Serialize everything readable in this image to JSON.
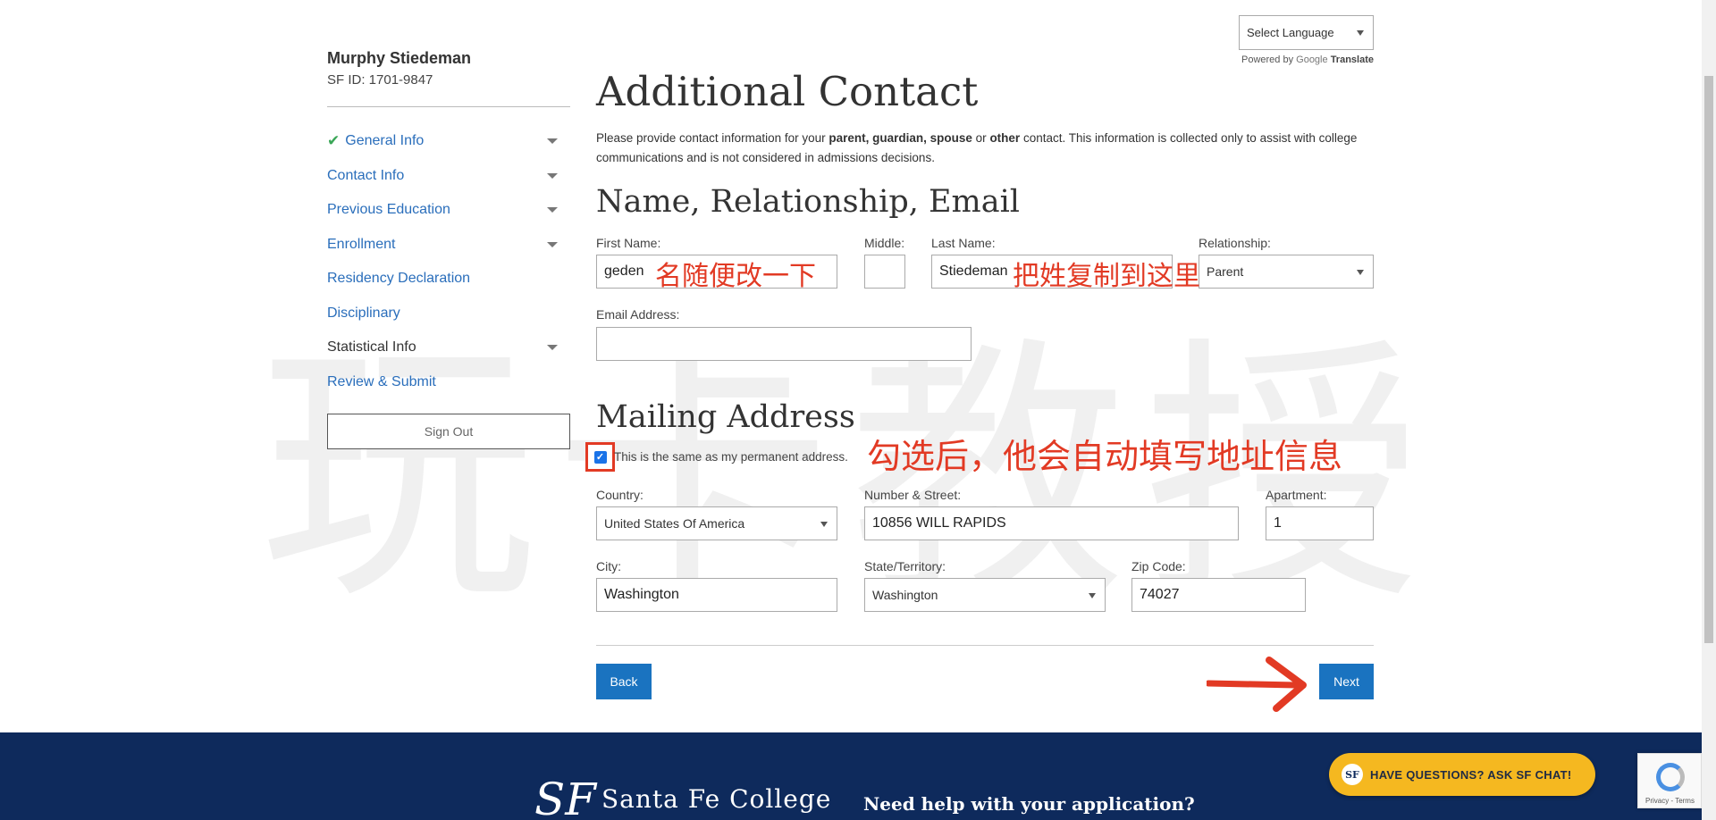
{
  "user": {
    "name": "Murphy Stiedeman",
    "id": "SF ID: 1701-9847"
  },
  "nav": [
    {
      "label": "General Info",
      "done": true,
      "caret": true,
      "dark": false
    },
    {
      "label": "Contact Info",
      "done": false,
      "caret": true,
      "dark": false
    },
    {
      "label": "Previous Education",
      "done": false,
      "caret": true,
      "dark": false
    },
    {
      "label": "Enrollment",
      "done": false,
      "caret": true,
      "dark": false
    },
    {
      "label": "Residency Declaration",
      "done": false,
      "caret": false,
      "dark": false
    },
    {
      "label": "Disciplinary",
      "done": false,
      "caret": false,
      "dark": false
    },
    {
      "label": "Statistical Info",
      "done": false,
      "caret": true,
      "dark": true
    },
    {
      "label": "Review & Submit",
      "done": false,
      "caret": false,
      "dark": false
    }
  ],
  "signout_label": "Sign Out",
  "language": {
    "select_label": "Select Language",
    "powered_by": "Powered by",
    "google": "Google",
    "translate": "Translate"
  },
  "page": {
    "title": "Additional Contact",
    "intro_before": "Please provide contact information for your ",
    "intro_bold1": "parent, guardian, spouse",
    "intro_mid": " or ",
    "intro_bold2": "other",
    "intro_after": " contact. This information is collected only to assist with college communications and is not considered in admissions decisions."
  },
  "section_name": {
    "heading": "Name, Relationship, Email",
    "first_name_label": "First Name:",
    "first_name_value": "geden",
    "middle_label": "Middle:",
    "middle_value": "",
    "last_name_label": "Last Name:",
    "last_name_value": "Stiedeman",
    "relationship_label": "Relationship:",
    "relationship_value": "Parent",
    "email_label": "Email Address:",
    "email_value": ""
  },
  "section_mailing": {
    "heading": "Mailing Address",
    "same_checkbox_label": "This is the same as my permanent address.",
    "same_checked": true,
    "country_label": "Country:",
    "country_value": "United States Of America",
    "street_label": "Number & Street:",
    "street_value": "10856 WILL RAPIDS",
    "apartment_label": "Apartment:",
    "apartment_value": "1",
    "city_label": "City:",
    "city_value": "Washington",
    "state_label": "State/Territory:",
    "state_value": "Washington",
    "zip_label": "Zip Code:",
    "zip_value": "74027"
  },
  "buttons": {
    "back": "Back",
    "next": "Next"
  },
  "annotations": {
    "first_name": "名随便改一下",
    "last_name": "把姓复制到这里",
    "checkbox": "勾选后，他会自动填写地址信息",
    "watermark": "玩卡教授"
  },
  "footer": {
    "logo_mark": "SF",
    "logo_name": "Santa Fe College",
    "help": "Need help with your application?",
    "chat_logo": "SF",
    "chat": "HAVE QUESTIONS? ASK SF CHAT!",
    "recaptcha": "Privacy - Terms"
  },
  "colors": {
    "link": "#2a6ebb",
    "button": "#1a73c0",
    "footer": "#0e2a5c",
    "chat": "#f5b820",
    "annotation": "#e23a24",
    "check": "#3aa657"
  }
}
